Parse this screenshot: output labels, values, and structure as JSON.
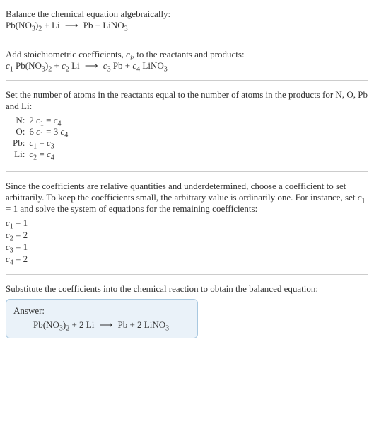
{
  "intro": {
    "line1": "Balance the chemical equation algebraically:"
  },
  "step1": {
    "text": "Add stoichiometric coefficients, "
  },
  "step2": {
    "text": "Set the number of atoms in the reactants equal to the number of atoms in the products for N, O, Pb and Li:"
  },
  "atoms": {
    "n": {
      "label": "N:",
      "eq": "2 c",
      "eq2": " = c"
    },
    "o": {
      "label": "O:",
      "eq": "6 c",
      "eq2": " = 3 c"
    },
    "pb": {
      "label": "Pb:",
      "eq": "c",
      "eq2": " = c"
    },
    "li": {
      "label": "Li:",
      "eq": "c",
      "eq2": " = c"
    }
  },
  "step3": {
    "text1": "Since the coefficients are relative quantities and underdetermined, choose a coefficient to set arbitrarily. To keep the coefficients small, the arbitrary value is ordinarily one. For instance, set ",
    "text2": " = 1 and solve the system of equations for the remaining coefficients:"
  },
  "solutions": {
    "c1": "1",
    "c2": "2",
    "c3": "1",
    "c4": "2"
  },
  "step4": {
    "text": "Substitute the coefficients into the chemical reaction to obtain the balanced equation:"
  },
  "answer": {
    "label": "Answer:"
  },
  "labels": {
    "reactants_products": ", to the reactants and products:"
  }
}
